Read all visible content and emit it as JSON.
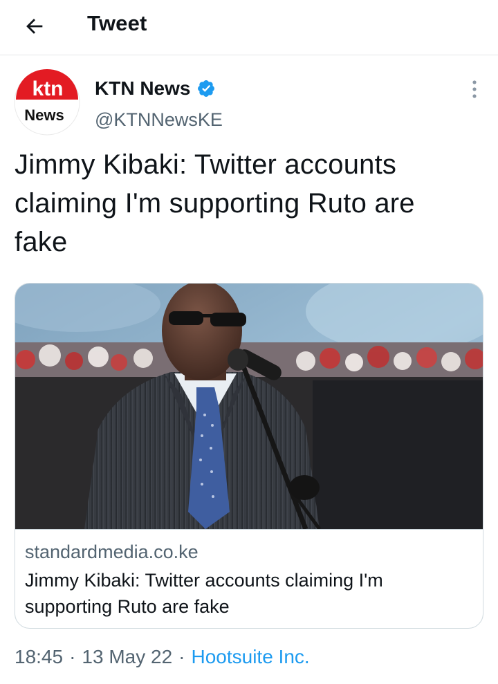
{
  "header": {
    "title": "Tweet",
    "back_icon": "arrow-left-icon"
  },
  "author": {
    "display_name": "KTN News",
    "handle": "@KTNNewsKE",
    "verified": true,
    "avatar": {
      "line1": "ktn",
      "line2": "News",
      "brand_red": "#e31b23"
    }
  },
  "tweet": {
    "text": "Jimmy Kibaki: Twitter accounts claiming I'm supporting Ruto are fake"
  },
  "card": {
    "domain": "standardmedia.co.ke",
    "title": "Jimmy Kibaki: Twitter accounts claiming I'm supporting Ruto are fake"
  },
  "meta": {
    "time": "18:45",
    "separator": "·",
    "date": "13 May 22",
    "source": "Hootsuite Inc."
  },
  "colors": {
    "text_primary": "#0f1419",
    "text_secondary": "#536471",
    "accent": "#1d9bf0",
    "border": "#cfd9de"
  }
}
